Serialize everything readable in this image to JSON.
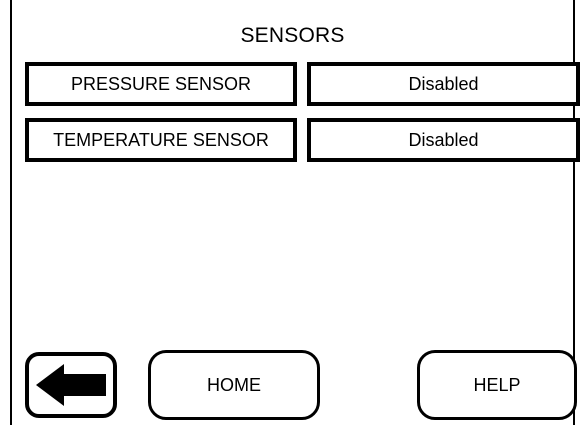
{
  "screen": {
    "title": "SENSORS"
  },
  "sensors": [
    {
      "label": "PRESSURE SENSOR",
      "status": "Disabled"
    },
    {
      "label": "TEMPERATURE SENSOR",
      "status": "Disabled"
    }
  ],
  "navigation": {
    "back_icon": "arrow-left-icon",
    "home_label": "HOME",
    "help_label": "HELP"
  },
  "colors": {
    "background": "#ffffff",
    "foreground": "#000000"
  }
}
